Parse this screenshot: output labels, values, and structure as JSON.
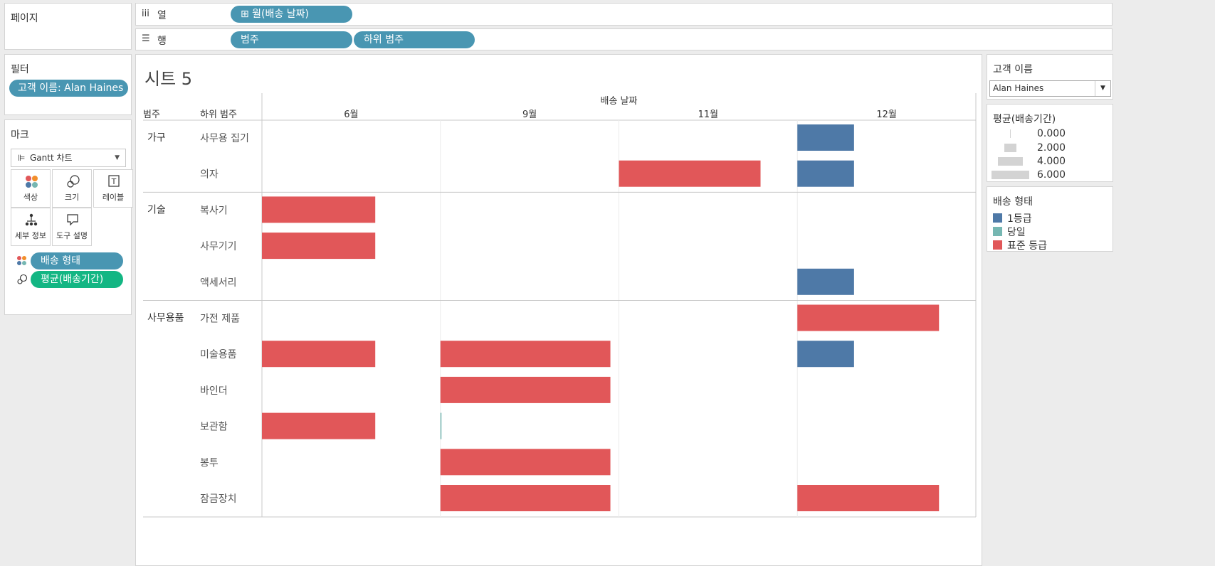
{
  "pages_shelf": {
    "title": "페이지"
  },
  "columns_shelf": {
    "icon": "iii",
    "label": "열",
    "pills": [
      "⊞ 월(배송 날짜)"
    ]
  },
  "rows_shelf": {
    "icon": "☰",
    "label": "행",
    "pills": [
      "범주",
      "하위 범주"
    ]
  },
  "filters": {
    "title": "필터",
    "pills": [
      "고객 이름: Alan Haines"
    ]
  },
  "marks": {
    "title": "마크",
    "mark_type": "Gantt 차트",
    "buttons": [
      {
        "name": "color",
        "label": "색상",
        "icon": "color-icon"
      },
      {
        "name": "size",
        "label": "크기",
        "icon": "size-icon"
      },
      {
        "name": "label",
        "label": "레이블",
        "icon": "label-icon"
      },
      {
        "name": "detail",
        "label": "세부 정보",
        "icon": "detail-icon"
      },
      {
        "name": "tooltip",
        "label": "도구 설명",
        "icon": "tooltip-icon"
      }
    ],
    "fields": [
      {
        "label": "배송 형태",
        "icon": "color-icon",
        "color": "#4996b2"
      },
      {
        "label": "평균(배송기간)",
        "icon": "size-icon",
        "color": "#13b683"
      }
    ]
  },
  "sheet": {
    "title": "시트 5",
    "column_header_title": "배송 날짜",
    "row_headers": [
      "범주",
      "하위 범주"
    ]
  },
  "chart_data": {
    "type": "gantt",
    "x_field": "배송 날짜",
    "months": [
      "6월",
      "9월",
      "11월",
      "12월"
    ],
    "categories": [
      {
        "name": "가구",
        "subcategories": [
          "사무용 집기",
          "의자"
        ]
      },
      {
        "name": "기술",
        "subcategories": [
          "복사기",
          "사무기기",
          "액세서리"
        ]
      },
      {
        "name": "사무용품",
        "subcategories": [
          "가전 제품",
          "미술용품",
          "바인더",
          "보관함",
          "봉투",
          "잠금장치"
        ]
      }
    ],
    "color_legend": [
      {
        "name": "1등급",
        "color": "#4e79a7"
      },
      {
        "name": "당일",
        "color": "#76b7b2"
      },
      {
        "name": "표준 등급",
        "color": "#e15759"
      }
    ],
    "size_legend": [
      "0.000",
      "2.000",
      "4.000",
      "6.000"
    ],
    "bars": [
      {
        "subcategory": "사무용 집기",
        "month": "12월",
        "ship_mode": "1등급",
        "duration": 2
      },
      {
        "subcategory": "의자",
        "month": "11월",
        "ship_mode": "표준 등급",
        "duration": 5
      },
      {
        "subcategory": "의자",
        "month": "12월",
        "ship_mode": "1등급",
        "duration": 2
      },
      {
        "subcategory": "복사기",
        "month": "6월",
        "ship_mode": "표준 등급",
        "duration": 4
      },
      {
        "subcategory": "사무기기",
        "month": "6월",
        "ship_mode": "표준 등급",
        "duration": 4
      },
      {
        "subcategory": "액세서리",
        "month": "12월",
        "ship_mode": "1등급",
        "duration": 2
      },
      {
        "subcategory": "가전 제품",
        "month": "12월",
        "ship_mode": "표준 등급",
        "duration": 5
      },
      {
        "subcategory": "미술용품",
        "month": "6월",
        "ship_mode": "표준 등급",
        "duration": 4
      },
      {
        "subcategory": "미술용품",
        "month": "9월",
        "ship_mode": "표준 등급",
        "duration": 6
      },
      {
        "subcategory": "미술용품",
        "month": "12월",
        "ship_mode": "1등급",
        "duration": 2
      },
      {
        "subcategory": "바인더",
        "month": "9월",
        "ship_mode": "표준 등급",
        "duration": 6
      },
      {
        "subcategory": "보관함",
        "month": "6월",
        "ship_mode": "표준 등급",
        "duration": 4
      },
      {
        "subcategory": "보관함",
        "month": "9월",
        "ship_mode": "당일",
        "duration": 0
      },
      {
        "subcategory": "봉투",
        "month": "9월",
        "ship_mode": "표준 등급",
        "duration": 6
      },
      {
        "subcategory": "잠금장치",
        "month": "9월",
        "ship_mode": "표준 등급",
        "duration": 6
      },
      {
        "subcategory": "잠금장치",
        "month": "12월",
        "ship_mode": "표준 등급",
        "duration": 5
      }
    ]
  },
  "customer_filter": {
    "title": "고객 이름",
    "value": "Alan Haines"
  },
  "size_legend_card": {
    "title": "평균(배송기간)"
  },
  "color_legend_card": {
    "title": "배송 형태"
  }
}
